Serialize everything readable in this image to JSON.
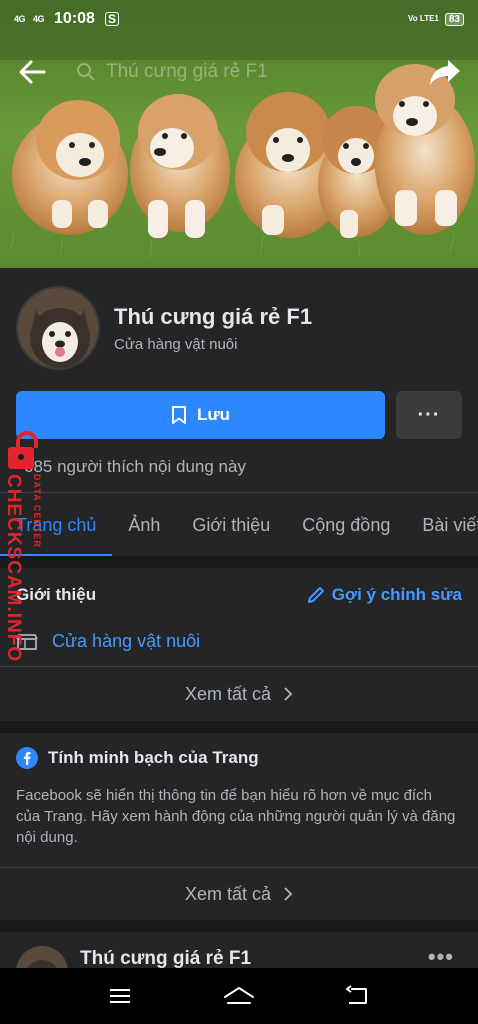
{
  "status_bar": {
    "signal1": "4G",
    "signal2": "4G",
    "time": "10:08",
    "notif_icon": "S",
    "volte": "Vo LTE1",
    "battery": "83"
  },
  "header": {
    "search_text": "Thú cưng giá rẻ F1"
  },
  "page": {
    "name": "Thú cưng giá rẻ F1",
    "category": "Cửa hàng vật nuôi",
    "save_label": "Lưu",
    "more_label": "···",
    "likes_text": "685 người thích nội dung này"
  },
  "tabs": [
    {
      "label": "Trang chủ"
    },
    {
      "label": "Ảnh"
    },
    {
      "label": "Giới thiệu"
    },
    {
      "label": "Cộng đồng"
    },
    {
      "label": "Bài viết"
    }
  ],
  "about": {
    "title": "Giới thiệu",
    "suggest_label": "Gợi ý chỉnh sửa",
    "category_item": "Cửa hàng vật nuôi",
    "see_all": "Xem tất cả"
  },
  "transparency": {
    "title": "Tính minh bạch của Trang",
    "description": "Facebook sẽ hiển thị thông tin để bạn hiểu rõ hơn về mục đích của Trang. Hãy xem hành động của những người quản lý và đăng nội dung.",
    "see_all": "Xem tất cả"
  },
  "post": {
    "author": "Thú cưng giá rẻ F1",
    "more_label": "•••"
  },
  "watermark": {
    "main": "CHECKSCAM.INFO",
    "sub": "DATA CENTER"
  },
  "colors": {
    "accent": "#2d88ff",
    "background": "#18191a",
    "card": "#242526",
    "watermark": "#e0262b"
  }
}
